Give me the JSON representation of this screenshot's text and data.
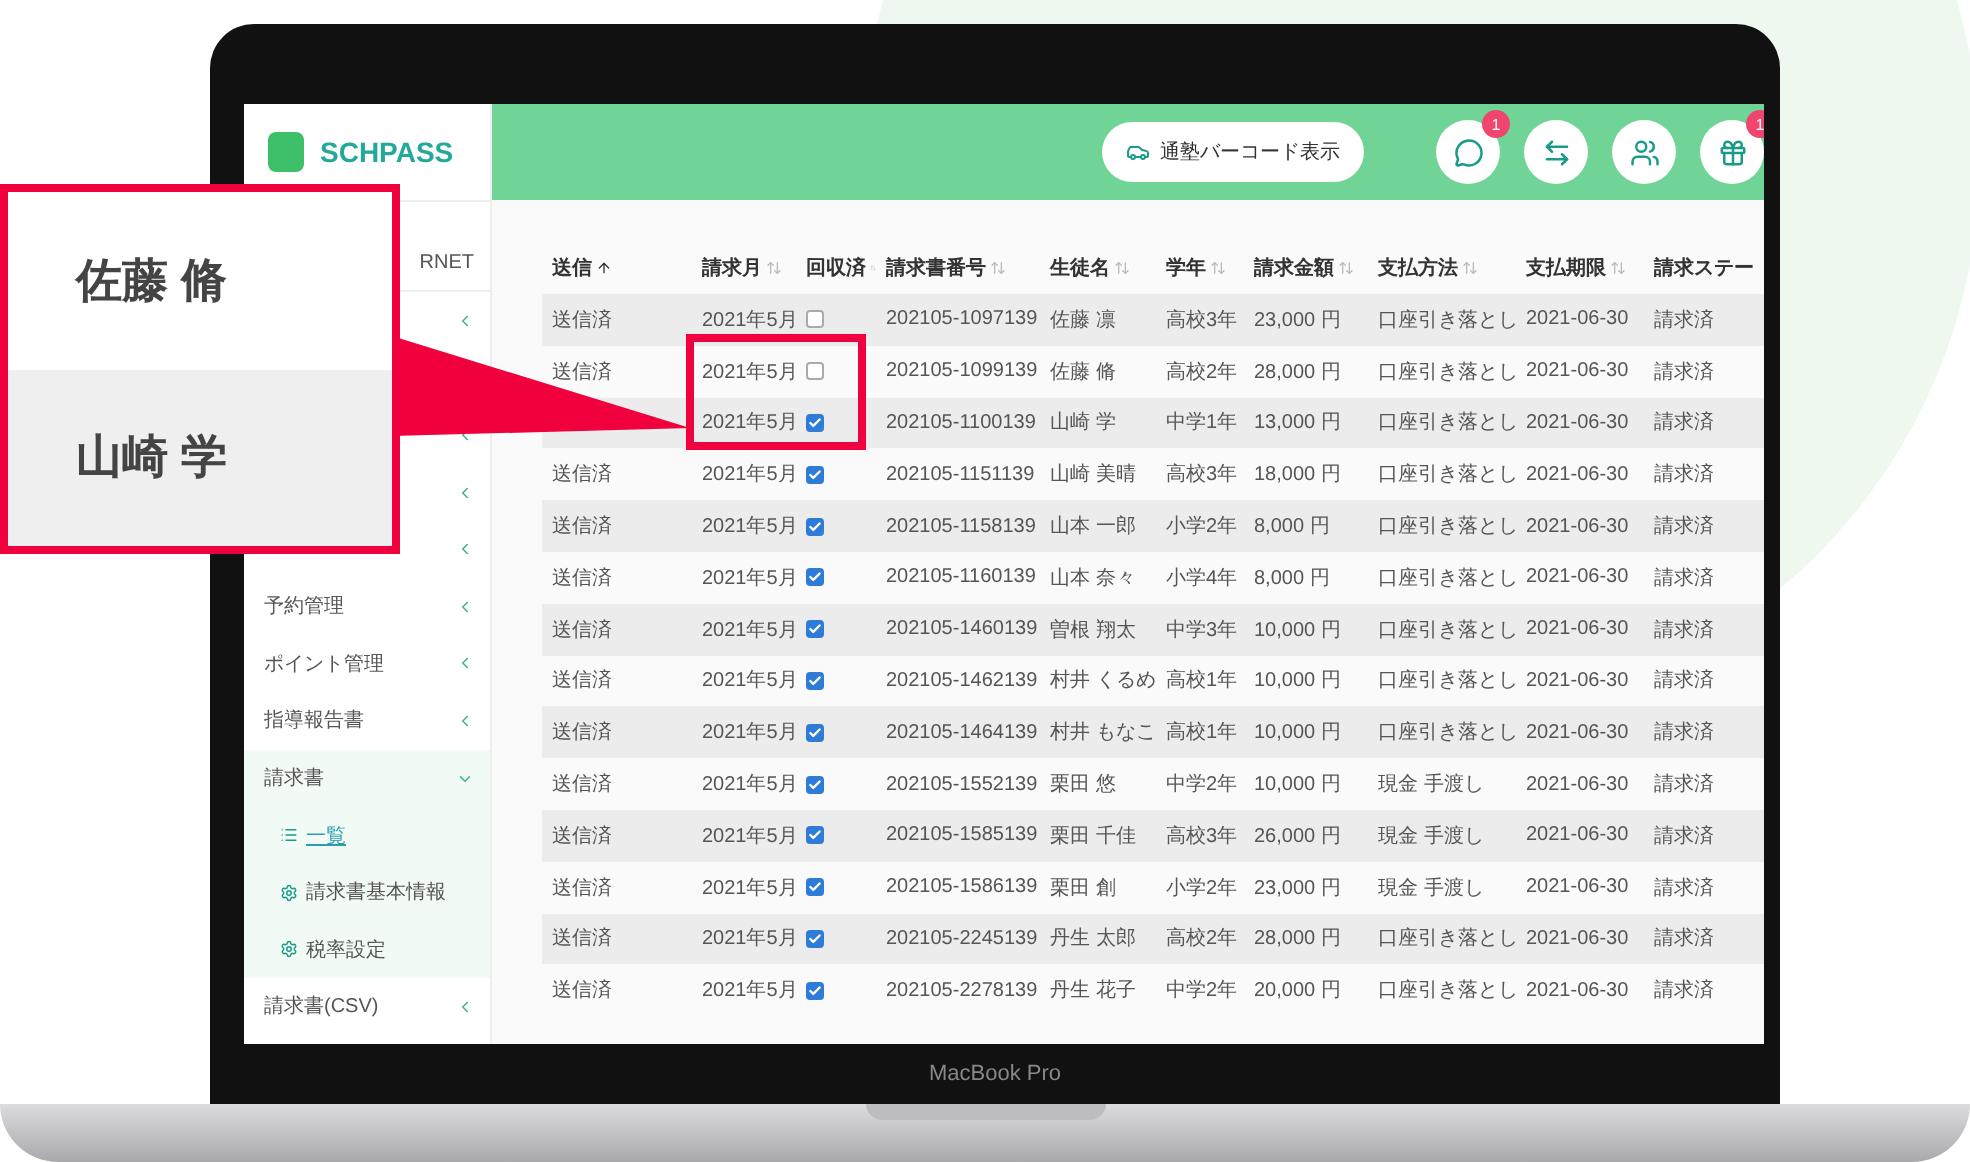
{
  "header": {
    "logo": "SCHPASS",
    "barcode_button": "通塾バーコード表示",
    "icons": [
      {
        "kind": "chat",
        "badge": "1"
      },
      {
        "kind": "swap"
      },
      {
        "kind": "people"
      },
      {
        "kind": "gift",
        "badge": "1"
      }
    ]
  },
  "sidebar": {
    "caption": "RNET",
    "items": [
      {
        "label": "予約管理",
        "expanded": false
      },
      {
        "label": "ポイント管理",
        "expanded": false
      },
      {
        "label": "指導報告書",
        "expanded": false
      },
      {
        "label": "請求書",
        "expanded": true,
        "children": [
          {
            "label": "一覧",
            "kind": "list",
            "selected": true
          },
          {
            "label": "請求書基本情報",
            "kind": "gear",
            "selected": false
          },
          {
            "label": "税率設定",
            "kind": "gear",
            "selected": false
          }
        ]
      },
      {
        "label": "請求書(CSV)",
        "expanded": false
      }
    ]
  },
  "table": {
    "columns": [
      {
        "label": "送信",
        "sorted": true
      },
      {
        "label": "請求月",
        "sorted": false
      },
      {
        "label": "回収済",
        "sorted": false
      },
      {
        "label": "請求書番号",
        "sorted": false
      },
      {
        "label": "生徒名",
        "sorted": false
      },
      {
        "label": "学年",
        "sorted": false
      },
      {
        "label": "請求金額",
        "sorted": false
      },
      {
        "label": "支払方法",
        "sorted": false
      },
      {
        "label": "支払期限",
        "sorted": false
      },
      {
        "label": "請求ステー"
      }
    ],
    "rows": [
      {
        "sent": "送信済",
        "month": "2021年5月",
        "collected": false,
        "number": "202105-1097139",
        "name": "佐藤 凛",
        "grade": "高校3年",
        "amount": "23,000 円",
        "method": "口座引き落とし",
        "due": "2021-06-30",
        "status": "請求済"
      },
      {
        "sent": "送信済",
        "month": "2021年5月",
        "collected": false,
        "number": "202105-1099139",
        "name": "佐藤 脩",
        "grade": "高校2年",
        "amount": "28,000 円",
        "method": "口座引き落とし",
        "due": "2021-06-30",
        "status": "請求済"
      },
      {
        "month": "2021年5月",
        "collected": true,
        "number": "202105-1100139",
        "name": "山崎 学",
        "grade": "中学1年",
        "amount": "13,000 円",
        "method": "口座引き落とし",
        "due": "2021-06-30",
        "status": "請求済"
      },
      {
        "sent": "送信済",
        "month": "2021年5月",
        "collected": true,
        "number": "202105-1151139",
        "name": "山崎 美晴",
        "grade": "高校3年",
        "amount": "18,000 円",
        "method": "口座引き落とし",
        "due": "2021-06-30",
        "status": "請求済"
      },
      {
        "sent": "送信済",
        "month": "2021年5月",
        "collected": true,
        "number": "202105-1158139",
        "name": "山本 一郎",
        "grade": "小学2年",
        "amount": "8,000 円",
        "method": "口座引き落とし",
        "due": "2021-06-30",
        "status": "請求済"
      },
      {
        "sent": "送信済",
        "month": "2021年5月",
        "collected": true,
        "number": "202105-1160139",
        "name": "山本 奈々",
        "grade": "小学4年",
        "amount": "8,000 円",
        "method": "口座引き落とし",
        "due": "2021-06-30",
        "status": "請求済"
      },
      {
        "sent": "送信済",
        "month": "2021年5月",
        "collected": true,
        "number": "202105-1460139",
        "name": "曽根 翔太",
        "grade": "中学3年",
        "amount": "10,000 円",
        "method": "口座引き落とし",
        "due": "2021-06-30",
        "status": "請求済"
      },
      {
        "sent": "送信済",
        "month": "2021年5月",
        "collected": true,
        "number": "202105-1462139",
        "name": "村井 くるめ",
        "grade": "高校1年",
        "amount": "10,000 円",
        "method": "口座引き落とし",
        "due": "2021-06-30",
        "status": "請求済"
      },
      {
        "sent": "送信済",
        "month": "2021年5月",
        "collected": true,
        "number": "202105-1464139",
        "name": "村井 もなこ",
        "grade": "高校1年",
        "amount": "10,000 円",
        "method": "口座引き落とし",
        "due": "2021-06-30",
        "status": "請求済"
      },
      {
        "sent": "送信済",
        "month": "2021年5月",
        "collected": true,
        "number": "202105-1552139",
        "name": "栗田 悠",
        "grade": "中学2年",
        "amount": "10,000 円",
        "method": "現金 手渡し",
        "due": "2021-06-30",
        "status": "請求済"
      },
      {
        "sent": "送信済",
        "month": "2021年5月",
        "collected": true,
        "number": "202105-1585139",
        "name": "栗田 千佳",
        "grade": "高校3年",
        "amount": "26,000 円",
        "method": "現金 手渡し",
        "due": "2021-06-30",
        "status": "請求済"
      },
      {
        "sent": "送信済",
        "month": "2021年5月",
        "collected": true,
        "number": "202105-1586139",
        "name": "栗田 創",
        "grade": "小学2年",
        "amount": "23,000 円",
        "method": "現金 手渡し",
        "due": "2021-06-30",
        "status": "請求済"
      },
      {
        "sent": "送信済",
        "month": "2021年5月",
        "collected": true,
        "number": "202105-2245139",
        "name": "丹生 太郎",
        "grade": "高校2年",
        "amount": "28,000 円",
        "method": "口座引き落とし",
        "due": "2021-06-30",
        "status": "請求済"
      },
      {
        "sent": "送信済",
        "month": "2021年5月",
        "collected": true,
        "number": "202105-2278139",
        "name": "丹生 花子",
        "grade": "中学2年",
        "amount": "20,000 円",
        "method": "口座引き落とし",
        "due": "2021-06-30",
        "status": "請求済"
      }
    ]
  },
  "laptop": {
    "model": "MacBook Pro"
  },
  "callout": {
    "names": [
      "佐藤 脩",
      "山崎 学"
    ]
  }
}
